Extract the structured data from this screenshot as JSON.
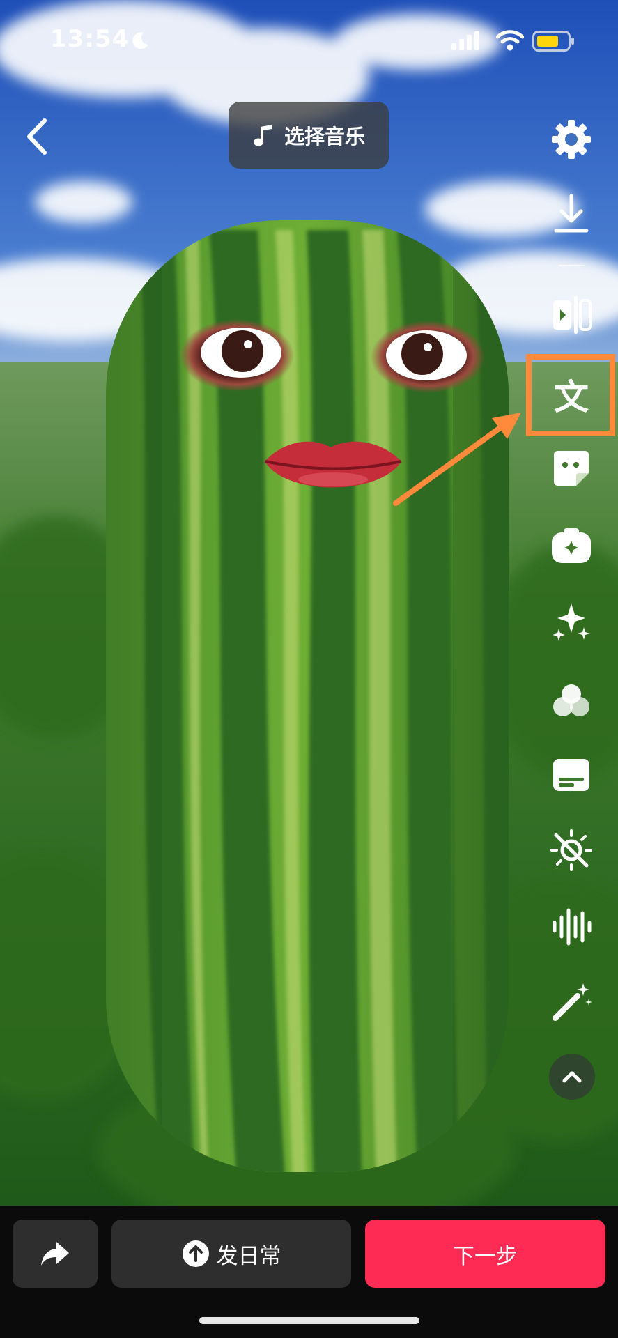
{
  "status_bar": {
    "time": "13:54"
  },
  "top": {
    "music_label": "选择音乐"
  },
  "toolbar": {
    "items": [
      "settings-icon",
      "download-icon",
      "cut-icon",
      "text-icon",
      "sticker-icon",
      "effects-icon",
      "sparkle-icon",
      "filter-icon",
      "subtitle-icon",
      "enhance-off-icon",
      "audio-icon",
      "magic-wand-icon"
    ],
    "highlighted": "text-icon",
    "text_glyph": "文"
  },
  "bottom": {
    "daily_label": "发日常",
    "next_label": "下一步"
  },
  "colors": {
    "accent": "#fe2c55",
    "highlight": "#ff8a3c",
    "battery": "#ffd60a"
  }
}
